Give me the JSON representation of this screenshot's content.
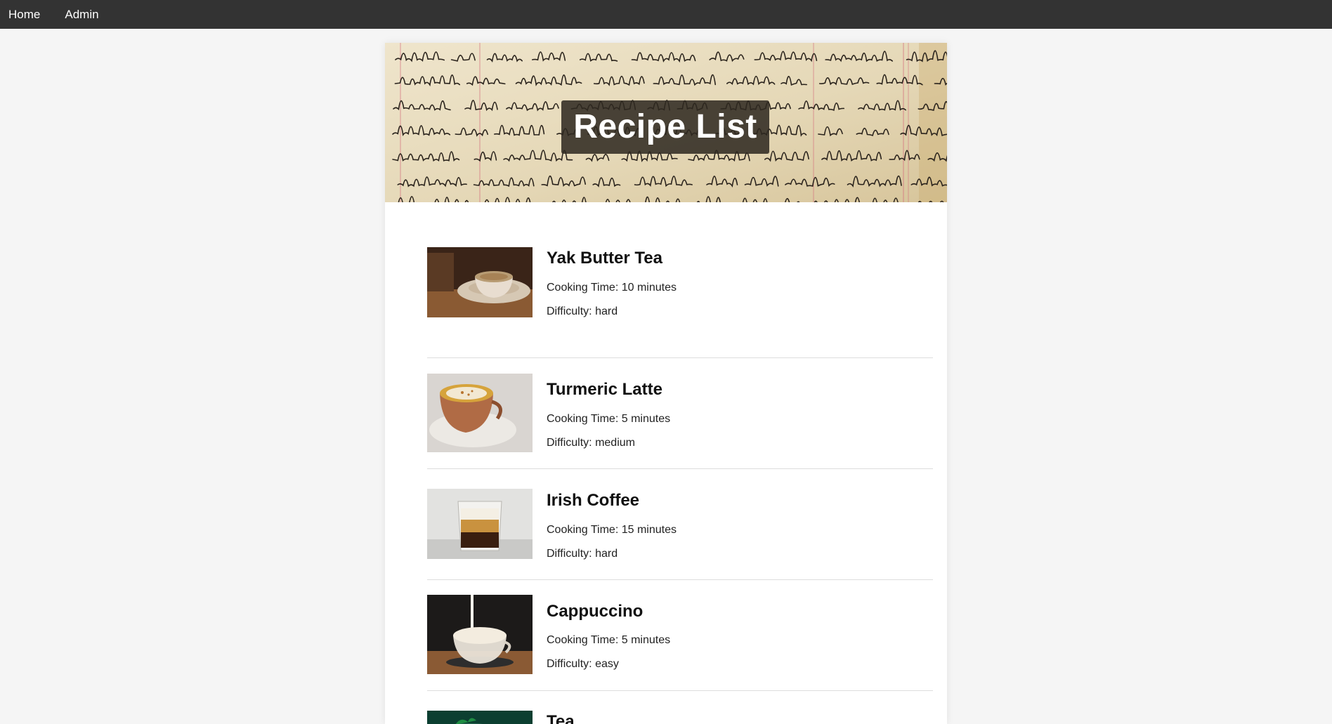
{
  "nav": {
    "links": [
      "Home",
      "Admin"
    ]
  },
  "header": {
    "title": "Recipe List"
  },
  "labels": {
    "cooking_time": "Cooking Time:",
    "difficulty": "Difficulty:"
  },
  "recipes": [
    {
      "name": "Yak Butter Tea",
      "cooking_time": "10 minutes",
      "difficulty": "hard"
    },
    {
      "name": "Turmeric Latte",
      "cooking_time": "5 minutes",
      "difficulty": "medium"
    },
    {
      "name": "Irish Coffee",
      "cooking_time": "15 minutes",
      "difficulty": "hard"
    },
    {
      "name": "Cappuccino",
      "cooking_time": "5 minutes",
      "difficulty": "easy"
    },
    {
      "name": "Tea"
    }
  ],
  "colors": {
    "nav_bg": "#333333",
    "page_bg": "#f5f5f5",
    "card_bg": "#ffffff"
  }
}
